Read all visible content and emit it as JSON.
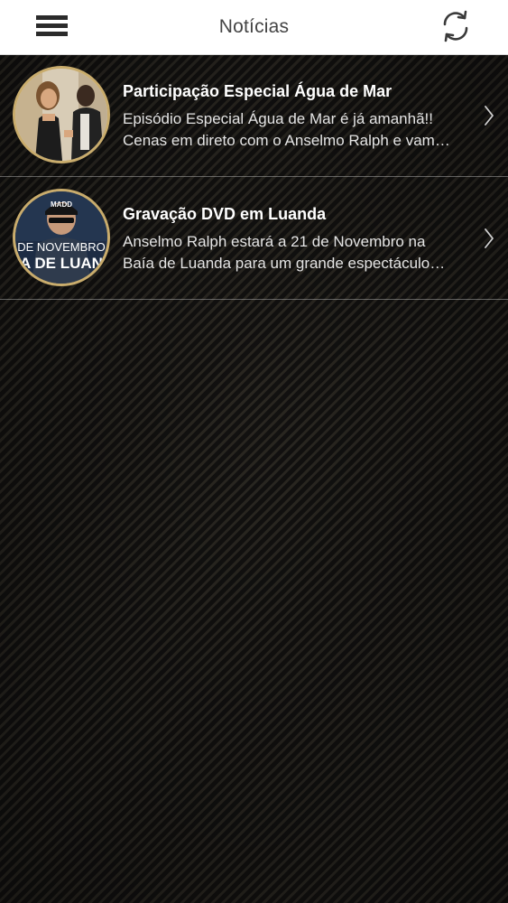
{
  "header": {
    "title": "Notícias",
    "menu_icon": "hamburger-menu-icon",
    "refresh_icon": "refresh-icon"
  },
  "news": [
    {
      "title": "Participação Especial Água de Mar",
      "desc_line1": "Episódio Especial Água de Mar é já amanhã!!",
      "desc_line2": "Cenas em direto com o Anselmo Ralph e vam…"
    },
    {
      "title": "Gravação DVD em Luanda",
      "desc_line1": "Anselmo Ralph estará a 21 de Novembro na",
      "desc_line2": "Baía de Luanda para um grande espectáculo…",
      "thumb_cap": "MADD",
      "thumb_line1": "DE NOVEMBRO",
      "thumb_line2": "A DE LUAN"
    }
  ],
  "colors": {
    "header_bg": "#ffffff",
    "thumb_border": "#c9ac6c",
    "text": "#ffffff"
  }
}
